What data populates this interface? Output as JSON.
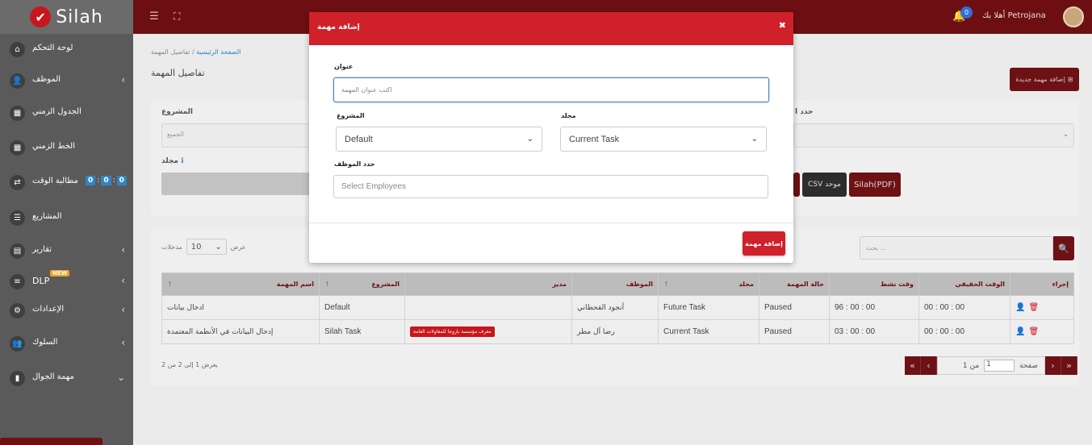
{
  "app": {
    "logo_text": "Silah"
  },
  "sidebar": {
    "items": [
      {
        "label": "لوحة التحكم",
        "icon": "home-icon"
      },
      {
        "label": "الموظف",
        "icon": "user-tie-icon"
      },
      {
        "label": "الجدول الزمني",
        "icon": "calendar-icon"
      },
      {
        "label": "الخط الزمني",
        "icon": "calendar-icon"
      },
      {
        "label": "مطالبة الوقت",
        "icon": "exchange-icon",
        "timer": [
          "0",
          "0",
          "0"
        ]
      },
      {
        "label": "المشاريع",
        "icon": "list-icon"
      },
      {
        "label": "تقارير",
        "icon": "report-icon"
      },
      {
        "label": "DLP",
        "icon": "sliders-icon",
        "badge": "NEW"
      },
      {
        "label": "الإعدادات",
        "icon": "gear-icon"
      },
      {
        "label": "السلوك",
        "icon": "user-gear-icon"
      },
      {
        "label": "مهمة الجوال",
        "icon": "mobile-icon"
      }
    ]
  },
  "topbar": {
    "notifications": "0",
    "greeting": "أهلا بك",
    "user": "Petrojana"
  },
  "page": {
    "breadcrumb_home": "الصفحة الرئيسية",
    "breadcrumb_sep": "/",
    "breadcrumb_current": "تفاصيل المهمة",
    "title": "تفاصيل المهمة",
    "add_task_button": "إضافة مهمة جديدة"
  },
  "filters": {
    "project_label": "المشروع",
    "project_value": "الجميع",
    "folder_label": "مجلد",
    "employee_label": "حدد ا",
    "employee_value": "",
    "csv_button": "CSV موحد",
    "pdf_button": "Silah(PDF)"
  },
  "table": {
    "show_label": "عرض",
    "entries_label": "مدخلات",
    "page_length": "10",
    "search_placeholder": "بحث ...",
    "headers": [
      "اسم المهمة",
      "المشروع",
      "مدير",
      "الموظف",
      "مجلد",
      "حالة المهمة",
      "وقت نشط",
      "الوقت الحقيقي",
      "إجراء"
    ],
    "rows": [
      {
        "name": "ادخال بيانات",
        "project": "Default",
        "manager": "",
        "employee": "أنجود القحطاني",
        "folder": "Future Task",
        "status": "Paused",
        "active": "96 : 00 : 00",
        "real": "00 : 00 : 00"
      },
      {
        "name": "إدخال البيانات في الأنظمة المعتمدة",
        "project": "Silah Task",
        "manager": "معرف مؤسسة بازوجا للمقاولات العامة",
        "employee": "رضا آل مطر",
        "folder": "Current Task",
        "status": "Paused",
        "active": "03 : 00 : 00",
        "real": "00 : 00 : 00"
      }
    ],
    "info": "يعرض 1 إلى 2 من 2",
    "page_label": "صفحة",
    "page_value": "1",
    "page_of": "من 1"
  },
  "modal": {
    "title": "إضافة مهمة",
    "title_label": "عنوان",
    "title_placeholder": "اكتب عنوان المهمة",
    "project_label": "المشروع",
    "project_value": "Default",
    "folder_label": "مجلد",
    "folder_value": "Current Task",
    "employees_label": "حدد الموظف",
    "employees_placeholder": "Select Employees",
    "submit": "إضافة مهمة"
  },
  "colors": {
    "brand": "#c8161d",
    "topbar": "#6d0f12",
    "sidebar": "#5a5a5a"
  }
}
